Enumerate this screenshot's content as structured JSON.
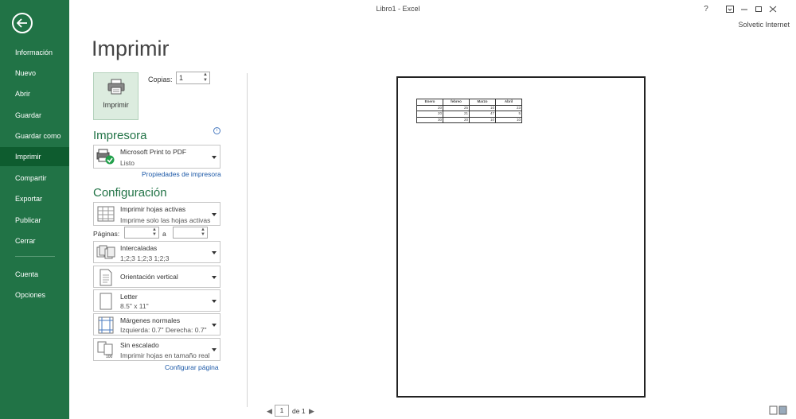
{
  "window": {
    "title": "Libro1 - Excel",
    "user": "Solvetic Internet",
    "help": "?"
  },
  "sidebar": {
    "items": [
      {
        "label": "Información"
      },
      {
        "label": "Nuevo"
      },
      {
        "label": "Abrir"
      },
      {
        "label": "Guardar"
      },
      {
        "label": "Guardar como"
      },
      {
        "label": "Imprimir",
        "active": true
      },
      {
        "label": "Compartir"
      },
      {
        "label": "Exportar"
      },
      {
        "label": "Publicar"
      },
      {
        "label": "Cerrar"
      }
    ],
    "bottom_items": [
      {
        "label": "Cuenta"
      },
      {
        "label": "Opciones"
      }
    ]
  },
  "main": {
    "heading": "Imprimir",
    "print_button": "Imprimir",
    "copies": {
      "label": "Copias:",
      "value": "1"
    },
    "printer": {
      "section": "Impresora",
      "name": "Microsoft Print to PDF",
      "status": "Listo",
      "properties_link": "Propiedades de impresora"
    },
    "settings": {
      "section": "Configuración",
      "what": {
        "title": "Imprimir hojas activas",
        "subtitle": "Imprime solo las hojas activas"
      },
      "pages": {
        "label": "Páginas:",
        "to": "a"
      },
      "collate": {
        "title": "Intercaladas",
        "subtitle": "1;2;3    1;2;3    1;2;3"
      },
      "orientation": {
        "title": "Orientación vertical"
      },
      "paper": {
        "title": "Letter",
        "subtitle": "8.5\" x 11\""
      },
      "margins": {
        "title": "Márgenes normales",
        "subtitle": "Izquierda:  0.7\"    Derecha:  0.7\""
      },
      "scaling": {
        "title": "Sin escalado",
        "subtitle": "Imprimir hojas en tamaño real"
      },
      "page_setup_link": "Configurar página"
    }
  },
  "preview": {
    "table": {
      "headers": [
        "Enero",
        "febreo",
        "Marzo",
        "Abril"
      ],
      "rows": [
        [
          "20",
          "25",
          "10",
          "23"
        ],
        [
          "20",
          "21",
          "47",
          "5"
        ],
        [
          "30",
          "20",
          "10",
          "10"
        ]
      ]
    },
    "page_nav": {
      "current": "1",
      "of": "de 1"
    }
  },
  "colors": {
    "accent": "#217346",
    "active_nav": "#0e5c2f",
    "link": "#1e5aa8"
  }
}
